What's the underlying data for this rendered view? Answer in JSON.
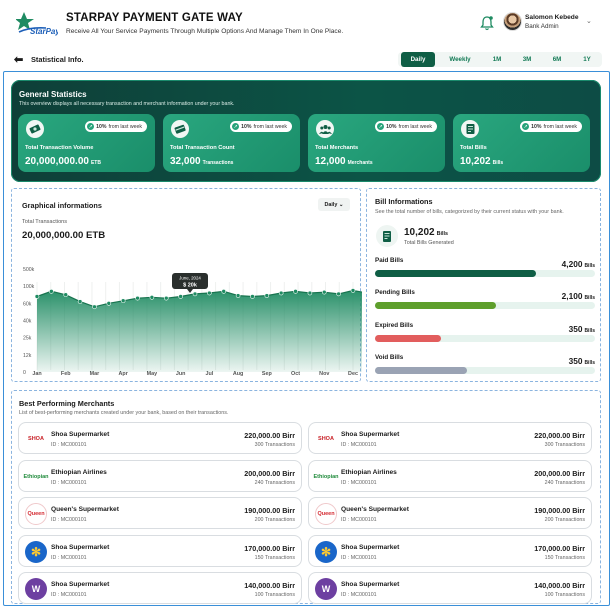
{
  "header": {
    "logo_text": "StarPay",
    "title": "STARPAY PAYMENT GATE WAY",
    "subtitle": "Receive All Your Service Payments Through Multiple Options And Manage Them In One Place.",
    "user_name": "Salomon Kebede",
    "user_role": "Bank Admin"
  },
  "subbar": {
    "title": "Statistical Info.",
    "filters": [
      "Daily",
      "Weekly",
      "1M",
      "3M",
      "6M",
      "1Y"
    ],
    "active_filter": "Daily"
  },
  "general": {
    "title": "General Statistics",
    "subtitle": "This overview displays all necessary transaction and merchant information under your bank.",
    "cards": [
      {
        "label": "Total Transaction Volume",
        "value": "20,000,000.00",
        "unit": "ETB",
        "change": "10%",
        "change_text": "from last week",
        "icon": "cash-icon"
      },
      {
        "label": "Total Transaction Count",
        "value": "32,000",
        "unit": "Transactions",
        "change": "10%",
        "change_text": "from last week",
        "icon": "card-icon"
      },
      {
        "label": "Total Merchants",
        "value": "12,000",
        "unit": "Merchants",
        "change": "10%",
        "change_text": "from last week",
        "icon": "group-icon"
      },
      {
        "label": "Total Bills",
        "value": "10,202",
        "unit": "Bills",
        "change": "10%",
        "change_text": "from last week",
        "icon": "bill-icon"
      }
    ]
  },
  "graph": {
    "title": "Graphical informations",
    "dropdown": "Daily",
    "sublabel": "Total Transactions",
    "value": "20,000,000.00 ETB",
    "tooltip_date": "June, 2024",
    "tooltip_value": "$ 20k"
  },
  "chart_data": {
    "type": "area",
    "categories": [
      "Jan",
      "Feb",
      "Mar",
      "Apr",
      "May",
      "Jun",
      "Jul",
      "Aug",
      "Sep",
      "Oct",
      "Nov",
      "Dec"
    ],
    "ytick_labels": [
      "0",
      "12k",
      "25k",
      "40k",
      "60k",
      "100k",
      "500k"
    ],
    "x": [
      0,
      0.5,
      1,
      1.5,
      2,
      2.5,
      3,
      3.5,
      4,
      4.5,
      5,
      5.5,
      6,
      6.5,
      7,
      7.5,
      8,
      8.5,
      9,
      9.5,
      10,
      10.5,
      11,
      11.5
    ],
    "values_tick_units": [
      4.4,
      4.7,
      4.5,
      4.1,
      3.8,
      4.0,
      4.15,
      4.3,
      4.35,
      4.3,
      4.4,
      4.55,
      4.6,
      4.7,
      4.45,
      4.4,
      4.45,
      4.6,
      4.7,
      4.6,
      4.65,
      4.55,
      4.75,
      4.6
    ],
    "series": [
      {
        "values": [
          4.4,
          4.7,
          4.5,
          4.1,
          3.8,
          4.0,
          4.15,
          4.3,
          4.35,
          4.3,
          4.4,
          4.55,
          4.6,
          4.7,
          4.45,
          4.4,
          4.45,
          4.6,
          4.7,
          4.6,
          4.65,
          4.55,
          4.75,
          4.6
        ]
      }
    ],
    "ylim": [
      0,
      6
    ],
    "grid": "vertical",
    "color": "#1f8b62"
  },
  "bills": {
    "title": "Bill Informations",
    "subtitle": "See the total number of bills, categorized by their current status with your bank.",
    "total": "10,202",
    "total_unit": "Bills",
    "total_label": "Total Bills Generated",
    "rows": [
      {
        "label": "Paid Bills",
        "value": "4,200",
        "unit": "Bills",
        "fraction": 0.73,
        "color": "#0f5e45"
      },
      {
        "label": "Pending Bills",
        "value": "2,100",
        "unit": "Bills",
        "fraction": 0.55,
        "color": "#5e9f2c"
      },
      {
        "label": "Expired Bills",
        "value": "350",
        "unit": "Bills",
        "fraction": 0.3,
        "color": "#e25d5d"
      },
      {
        "label": "Void Bills",
        "value": "350",
        "unit": "Bills",
        "fraction": 0.42,
        "color": "#9aa3b4"
      }
    ]
  },
  "merchants": {
    "title": "Best Performing Merchants",
    "subtitle": "List of best-performing merchants created under your bank, based on their transactions.",
    "rows": [
      {
        "name": "Shoa Supermarket",
        "id": "ID : MC000101",
        "amount": "220,000.00 Birr",
        "tx": "300 Transactions",
        "logo": "shoa-logo",
        "logo_text": "SHOA"
      },
      {
        "name": "Ethiopian Airlines",
        "id": "ID : MC000101",
        "amount": "200,000.00 Birr",
        "tx": "240 Transactions",
        "logo": "ethiopian-logo",
        "logo_text": "Ethiopian"
      },
      {
        "name": "Queen's Supermarket",
        "id": "ID : MC000101",
        "amount": "190,000.00 Birr",
        "tx": "200 Transactions",
        "logo": "queens-logo",
        "logo_text": "Queen"
      },
      {
        "name": "Shoa Supermarket",
        "id": "ID : MC000101",
        "amount": "170,000.00 Birr",
        "tx": "150 Transactions",
        "logo": "walmart-logo",
        "logo_text": "✻"
      },
      {
        "name": "Shoa Supermarket",
        "id": "ID : MC000101",
        "amount": "140,000.00 Birr",
        "tx": "100 Transactions",
        "logo": "purple-logo",
        "logo_text": "W"
      }
    ]
  }
}
